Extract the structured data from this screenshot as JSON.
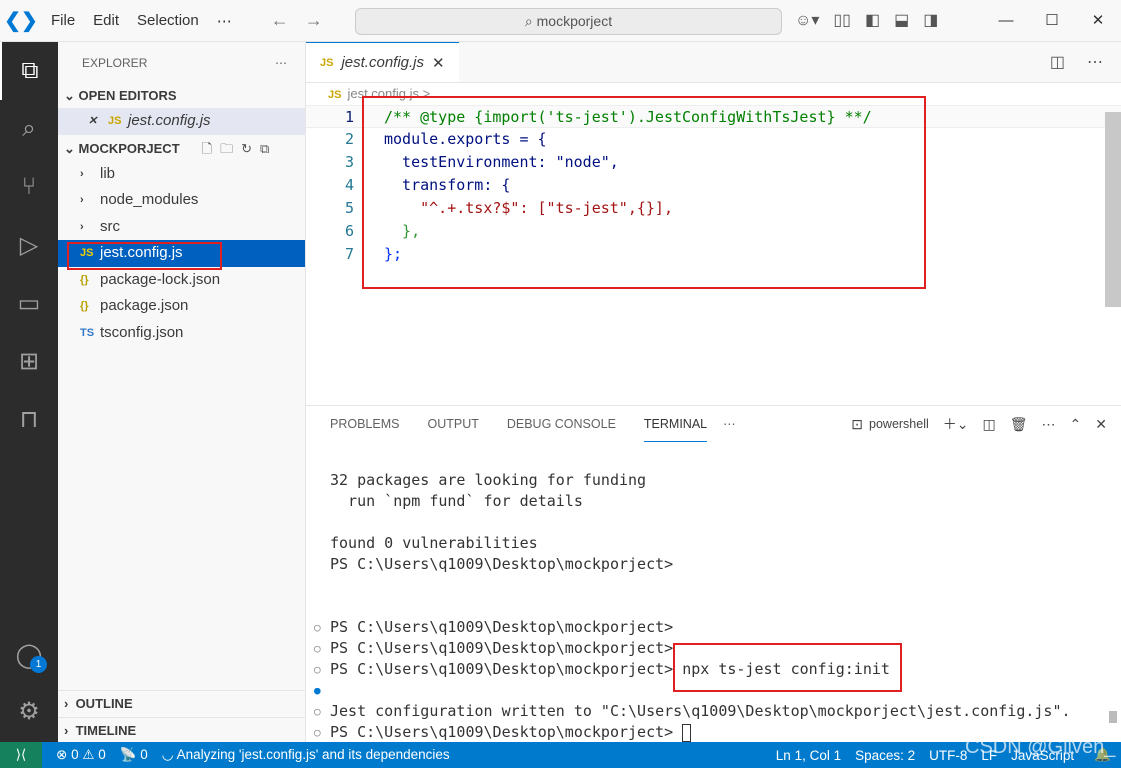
{
  "titlebar": {
    "menu": [
      "File",
      "Edit",
      "Selection",
      "⋯"
    ],
    "search": "mockporject"
  },
  "sidebar": {
    "title": "EXPLORER",
    "open_editors": "OPEN EDITORS",
    "open_file": "jest.config.js",
    "project": "MOCKPORJECT",
    "items": [
      {
        "label": "lib",
        "type": "folder"
      },
      {
        "label": "node_modules",
        "type": "folder"
      },
      {
        "label": "src",
        "type": "folder"
      },
      {
        "label": "jest.config.js",
        "type": "js",
        "selected": true
      },
      {
        "label": "package-lock.json",
        "type": "json"
      },
      {
        "label": "package.json",
        "type": "json"
      },
      {
        "label": "tsconfig.json",
        "type": "ts"
      }
    ],
    "outline": "OUTLINE",
    "timeline": "TIMELINE",
    "accounts_badge": "1"
  },
  "editor": {
    "tab": "jest.config.js",
    "breadcrumb": "jest.config.js > ...",
    "lines": [
      "/** @type {import('ts-jest').JestConfigWithTsJest} **/",
      "module.exports = {",
      "  testEnvironment: \"node\",",
      "  transform: {",
      "    \"^.+.tsx?$\": [\"ts-jest\",{}],",
      "  },",
      "};"
    ]
  },
  "panel": {
    "tabs": [
      "PROBLEMS",
      "OUTPUT",
      "DEBUG CONSOLE",
      "TERMINAL"
    ],
    "active": "TERMINAL",
    "shell": "powershell",
    "terminal": [
      "32 packages are looking for funding",
      "  run `npm fund` for details",
      "",
      "found 0 vulnerabilities",
      "PS C:\\Users\\q1009\\Desktop\\mockporject>",
      "",
      "",
      "PS C:\\Users\\q1009\\Desktop\\mockporject>",
      "PS C:\\Users\\q1009\\Desktop\\mockporject>",
      "PS C:\\Users\\q1009\\Desktop\\mockporject> npx ts-jest config:init",
      "",
      "Jest configuration written to \"C:\\Users\\q1009\\Desktop\\mockporject\\jest.config.js\".",
      "PS C:\\Users\\q1009\\Desktop\\mockporject> "
    ]
  },
  "status": {
    "errors": "0",
    "warnings": "0",
    "ports": "0",
    "analyzing": "Analyzing 'jest.config.js' and its dependencies",
    "position": "Ln 1, Col 1",
    "spaces": "Spaces: 2",
    "encoding": "UTF-8",
    "eol": "LF",
    "language": "JavaScript",
    "watermark": "CSDN @Gliven_"
  },
  "colors": {
    "accent": "#007acc",
    "highlight": "#e02020"
  }
}
